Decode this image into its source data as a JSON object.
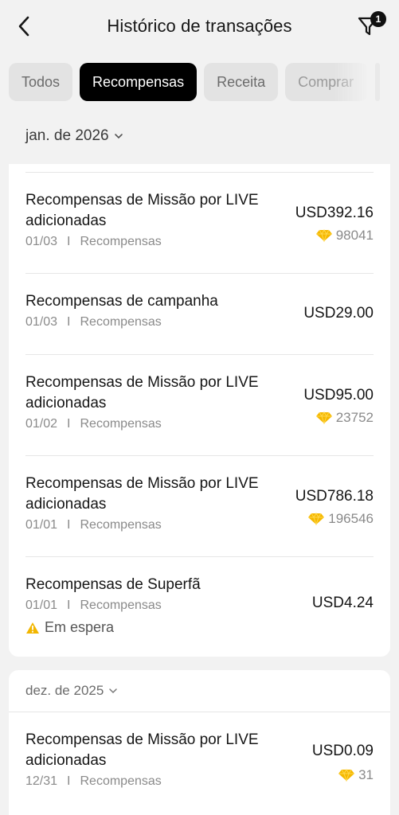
{
  "header": {
    "title": "Histórico de transações",
    "filter_badge": "1"
  },
  "tabs": [
    "Todos",
    "Recompensas",
    "Receita",
    "Comprar"
  ],
  "active_tab": "Recompensas",
  "month_jan": "jan. de 2026",
  "transactions_jan": [
    {
      "title_line1": "Recompensas de Missão por LIVE",
      "title_line2": "adicionadas",
      "date": "01/03",
      "category": "Recompensas",
      "amount": "USD392.16",
      "coins": "98041"
    },
    {
      "title_line1": "Recompensas de campanha",
      "title_line2": "",
      "date": "01/03",
      "category": "Recompensas",
      "amount": "USD29.00",
      "coins": ""
    },
    {
      "title_line1": "Recompensas de Missão por LIVE",
      "title_line2": "adicionadas",
      "date": "01/02",
      "category": "Recompensas",
      "amount": "USD95.00",
      "coins": "23752"
    },
    {
      "title_line1": "Recompensas de Missão por LIVE",
      "title_line2": "adicionadas",
      "date": "01/01",
      "category": "Recompensas",
      "amount": "USD786.18",
      "coins": "196546"
    },
    {
      "title_line1": "Recompensas de Superfã",
      "title_line2": "",
      "date": "01/01",
      "category": "Recompensas",
      "amount": "USD4.24",
      "coins": "",
      "status": "Em espera"
    }
  ],
  "month_dec": "dez. de 2025",
  "transactions_dec": [
    {
      "title_line1": "Recompensas de Missão por LIVE",
      "title_line2": "adicionadas",
      "date": "12/31",
      "category": "Recompensas",
      "amount": "USD0.09",
      "coins": "31"
    }
  ],
  "separator": "I",
  "colors": {
    "accent": "#000000",
    "coin": "#f5b800",
    "warning": "#f2b600"
  },
  "icons": {
    "back": "chevron-left-icon",
    "filter": "filter-funnel-icon",
    "coin": "diamond-coin-icon",
    "warning": "warning-triangle-icon"
  }
}
